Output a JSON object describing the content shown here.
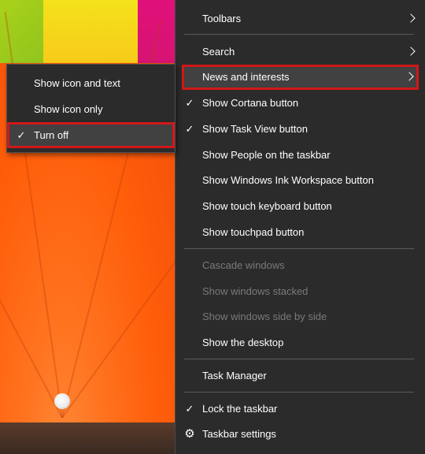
{
  "main_menu": {
    "items": [
      {
        "label": "Toolbars",
        "checked": false,
        "submenu": true,
        "disabled": false
      },
      {
        "label": "Search",
        "checked": false,
        "submenu": true,
        "disabled": false
      },
      {
        "label": "News and interests",
        "checked": false,
        "submenu": true,
        "disabled": false,
        "highlighted": true
      },
      {
        "label": "Show Cortana button",
        "checked": true,
        "submenu": false,
        "disabled": false
      },
      {
        "label": "Show Task View button",
        "checked": true,
        "submenu": false,
        "disabled": false
      },
      {
        "label": "Show People on the taskbar",
        "checked": false,
        "submenu": false,
        "disabled": false
      },
      {
        "label": "Show Windows Ink Workspace button",
        "checked": false,
        "submenu": false,
        "disabled": false
      },
      {
        "label": "Show touch keyboard button",
        "checked": false,
        "submenu": false,
        "disabled": false
      },
      {
        "label": "Show touchpad button",
        "checked": false,
        "submenu": false,
        "disabled": false
      },
      {
        "label": "Cascade windows",
        "checked": false,
        "submenu": false,
        "disabled": true
      },
      {
        "label": "Show windows stacked",
        "checked": false,
        "submenu": false,
        "disabled": true
      },
      {
        "label": "Show windows side by side",
        "checked": false,
        "submenu": false,
        "disabled": true
      },
      {
        "label": "Show the desktop",
        "checked": false,
        "submenu": false,
        "disabled": false
      },
      {
        "label": "Task Manager",
        "checked": false,
        "submenu": false,
        "disabled": false
      },
      {
        "label": "Lock the taskbar",
        "checked": true,
        "submenu": false,
        "disabled": false
      },
      {
        "label": "Taskbar settings",
        "checked": false,
        "submenu": false,
        "disabled": false,
        "icon": "gear-icon"
      }
    ]
  },
  "sub_menu": {
    "items": [
      {
        "label": "Show icon and text",
        "checked": false
      },
      {
        "label": "Show icon only",
        "checked": false
      },
      {
        "label": "Turn off",
        "checked": true,
        "highlighted": true
      }
    ]
  },
  "glyphs": {
    "check": "✓",
    "gear": "⚙"
  },
  "colors": {
    "menu_bg": "#2b2b2b",
    "highlight_bg": "#414141",
    "annotation_red": "#d01818",
    "disabled_text": "#7a7a7a"
  }
}
